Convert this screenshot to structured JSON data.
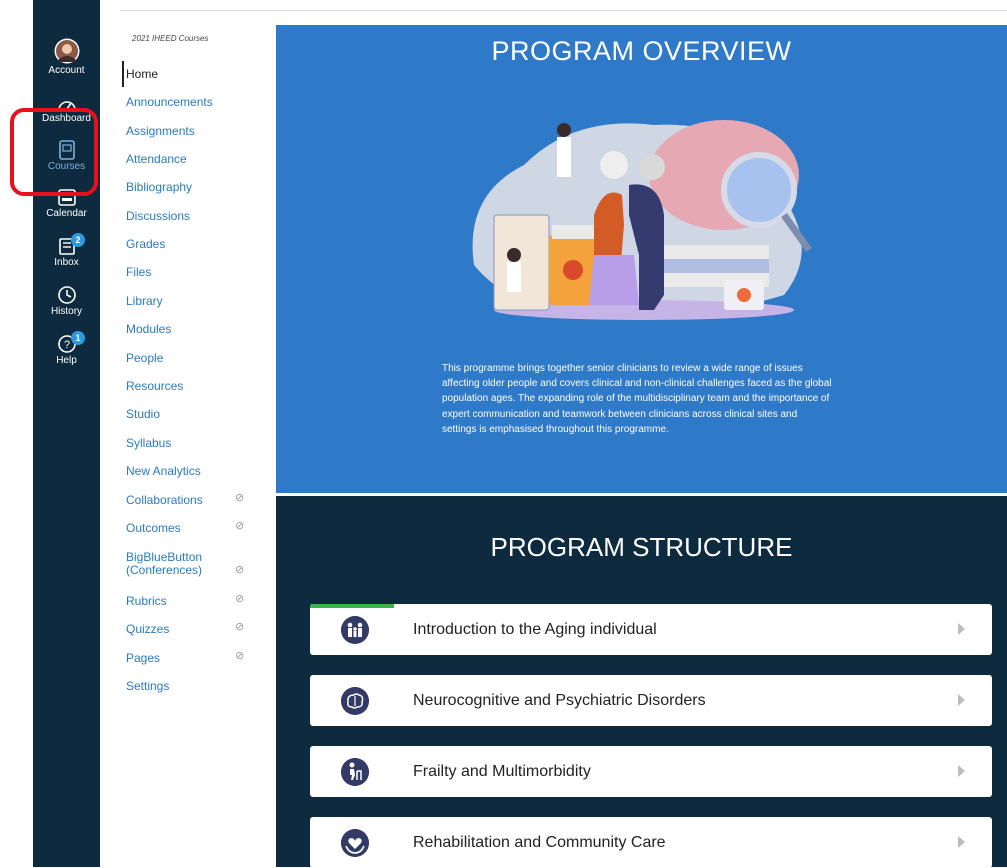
{
  "global_nav": {
    "items": [
      {
        "label": "Account",
        "icon": "avatar"
      },
      {
        "label": "Dashboard",
        "icon": "dashboard-icon"
      },
      {
        "label": "Courses",
        "icon": "courses-icon"
      },
      {
        "label": "Calendar",
        "icon": "calendar-icon"
      },
      {
        "label": "Inbox",
        "icon": "inbox-icon",
        "badge": "2"
      },
      {
        "label": "History",
        "icon": "history-icon"
      },
      {
        "label": "Help",
        "icon": "help-icon",
        "badge": "1"
      }
    ],
    "highlight_color": "#e8101a"
  },
  "course_nav": {
    "breadcrumb": "2021 IHEED Courses",
    "items": [
      {
        "label": "Home"
      },
      {
        "label": "Announcements"
      },
      {
        "label": "Assignments"
      },
      {
        "label": "Attendance"
      },
      {
        "label": "Bibliography"
      },
      {
        "label": "Discussions"
      },
      {
        "label": "Grades"
      },
      {
        "label": "Files"
      },
      {
        "label": "Library"
      },
      {
        "label": "Modules"
      },
      {
        "label": "People"
      },
      {
        "label": "Resources"
      },
      {
        "label": "Studio"
      },
      {
        "label": "Syllabus"
      },
      {
        "label": "New Analytics"
      },
      {
        "label": "Collaborations"
      },
      {
        "label": "Outcomes"
      },
      {
        "label": "BigBlueButton"
      },
      {
        "label": "(Conferences)"
      },
      {
        "label": "Rubrics"
      },
      {
        "label": "Quizzes"
      },
      {
        "label": "Pages"
      },
      {
        "label": "Settings"
      }
    ],
    "link_color": "#2b7abc"
  },
  "overview": {
    "title": "PROGRAM OVERVIEW",
    "description": "This programme brings together senior clinicians to review a wide range of issues affecting older people and covers clinical and non-clinical challenges faced as the global population ages. The expanding role of the multidisciplinary team and the importance of expert communication and teamwork between clinicians across clinical sites and settings is emphasised throughout this programme.",
    "bg_color": "#2f79c9"
  },
  "structure": {
    "title": "PROGRAM STRUCTURE",
    "bg_color": "#0d2a3f",
    "modules": [
      {
        "title": "Introduction to the Aging individual",
        "icon": "family-icon",
        "progress": 0.12
      },
      {
        "title": "Neurocognitive and Psychiatric Disorders",
        "icon": "brain-icon"
      },
      {
        "title": "Frailty and Multimorbidity",
        "icon": "elderly-walker-icon"
      },
      {
        "title": "Rehabilitation and Community Care",
        "icon": "heart-hands-icon"
      }
    ]
  }
}
